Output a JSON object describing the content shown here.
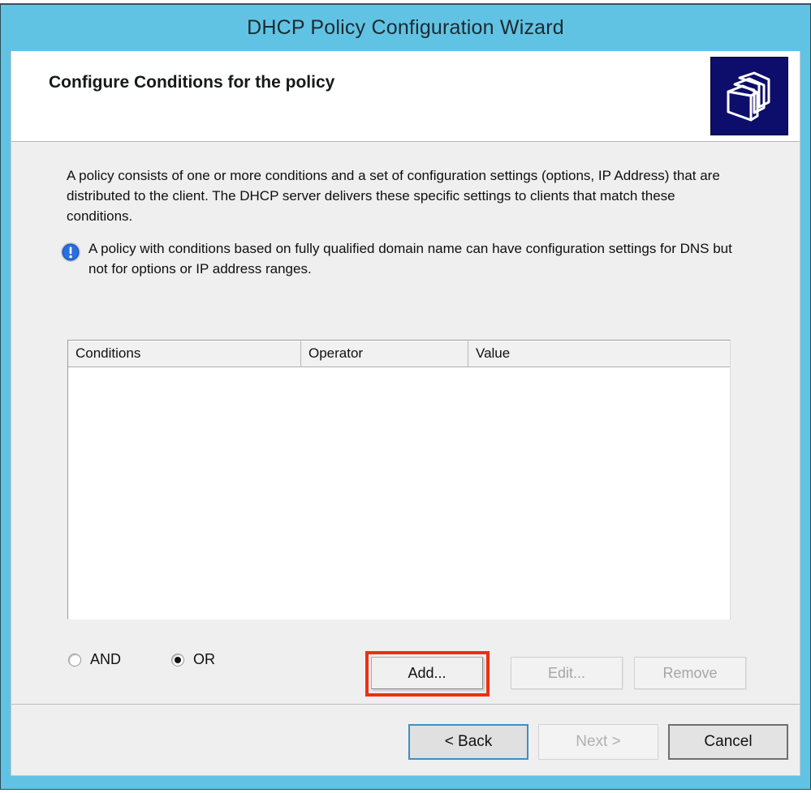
{
  "window": {
    "title": "DHCP Policy Configuration Wizard",
    "accent_color": "#61c3e4",
    "body_color": "#efefef"
  },
  "header": {
    "title": "Configure Conditions for the policy",
    "icon": "folders-icon"
  },
  "body": {
    "intro_text": "A policy consists of one or more conditions and a set of configuration settings (options, IP Address) that are distributed to the client. The DHCP server delivers these specific settings to clients that match these conditions.",
    "note_icon": "info-icon",
    "note_text": "A policy with conditions based on fully qualified domain name can have configuration settings for DNS but not for options or IP address ranges."
  },
  "conditions_table": {
    "columns": [
      "Conditions",
      "Operator",
      "Value"
    ],
    "rows": []
  },
  "logic_operator": {
    "options": [
      {
        "label": "AND",
        "selected": false
      },
      {
        "label": "OR",
        "selected": true
      }
    ]
  },
  "action_buttons": {
    "add": {
      "label": "Add...",
      "enabled": true,
      "highlighted": true,
      "highlight_color": "#ee2f10"
    },
    "edit": {
      "label": "Edit...",
      "enabled": false
    },
    "remove": {
      "label": "Remove",
      "enabled": false
    }
  },
  "footer_buttons": {
    "back": {
      "label": "< Back",
      "enabled": true,
      "focused": true
    },
    "next": {
      "label": "Next >",
      "enabled": false
    },
    "cancel": {
      "label": "Cancel",
      "enabled": true
    }
  }
}
